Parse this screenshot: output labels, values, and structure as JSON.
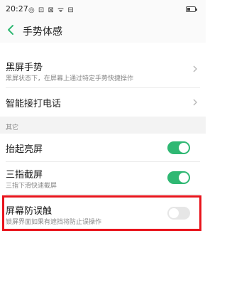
{
  "status_bar": {
    "time": "20:27",
    "icons": "◎ ⊡ ⊠ ᯤ ⊟"
  },
  "header": {
    "title": "手势体感"
  },
  "rows": {
    "black_screen": {
      "title": "黑屏手势",
      "subtitle": "黑屏状态下，在屏幕上通过特定手势快捷操作"
    },
    "smart_answer": {
      "title": "智能接打电话"
    }
  },
  "section_other": {
    "label": "其它"
  },
  "toggles": {
    "raise_wake": {
      "title": "抬起亮屏",
      "state": "on"
    },
    "three_finger": {
      "title": "三指截屏",
      "subtitle": "三指下滑快速截屏",
      "state": "on"
    },
    "anti_touch": {
      "title": "屏幕防误触",
      "subtitle": "锁屏界面如果有遮挡将防止误操作",
      "state": "off"
    }
  },
  "colors": {
    "toggle_on": "#2fb873",
    "toggle_off": "#e6e6e6",
    "highlight": "#e8141c"
  }
}
